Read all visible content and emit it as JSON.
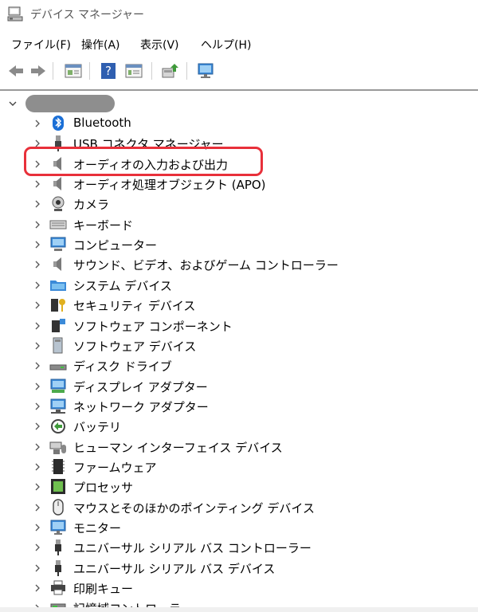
{
  "window": {
    "title": "デバイス マネージャー"
  },
  "menu": {
    "items": [
      "ファイル(F)",
      "操作(A)",
      "表示(V)",
      "ヘルプ(H)"
    ]
  },
  "toolbar": {
    "buttons": [
      "back",
      "forward",
      "properties",
      "help",
      "view-hidden",
      "update-driver",
      "scan-hardware"
    ]
  },
  "tree": {
    "root_label_redacted": true,
    "items": [
      {
        "label": "Bluetooth",
        "icon": "bluetooth-icon"
      },
      {
        "label": "USB コネクタ マネージャー",
        "icon": "usb-connector-icon"
      },
      {
        "label": "オーディオの入力および出力",
        "icon": "speaker-icon",
        "highlighted": true
      },
      {
        "label": "オーディオ処理オブジェクト (APO)",
        "icon": "speaker-icon"
      },
      {
        "label": "カメラ",
        "icon": "camera-icon"
      },
      {
        "label": "キーボード",
        "icon": "keyboard-icon"
      },
      {
        "label": "コンピューター",
        "icon": "computer-icon"
      },
      {
        "label": "サウンド、ビデオ、およびゲーム コントローラー",
        "icon": "speaker-icon"
      },
      {
        "label": "システム デバイス",
        "icon": "system-folder-icon"
      },
      {
        "label": "セキュリティ デバイス",
        "icon": "security-key-icon"
      },
      {
        "label": "ソフトウェア コンポーネント",
        "icon": "software-component-icon"
      },
      {
        "label": "ソフトウェア デバイス",
        "icon": "software-device-icon"
      },
      {
        "label": "ディスク ドライブ",
        "icon": "disk-drive-icon"
      },
      {
        "label": "ディスプレイ アダプター",
        "icon": "display-adapter-icon"
      },
      {
        "label": "ネットワーク アダプター",
        "icon": "network-adapter-icon"
      },
      {
        "label": "バッテリ",
        "icon": "battery-icon"
      },
      {
        "label": "ヒューマン インターフェイス デバイス",
        "icon": "hid-icon"
      },
      {
        "label": "ファームウェア",
        "icon": "firmware-chip-icon"
      },
      {
        "label": "プロセッサ",
        "icon": "processor-icon"
      },
      {
        "label": "マウスとそのほかのポインティング デバイス",
        "icon": "mouse-icon"
      },
      {
        "label": "モニター",
        "icon": "monitor-icon"
      },
      {
        "label": "ユニバーサル シリアル バス コントローラー",
        "icon": "usb-plug-icon"
      },
      {
        "label": "ユニバーサル シリアル バス デバイス",
        "icon": "usb-plug-icon"
      },
      {
        "label": "印刷キュー",
        "icon": "printer-icon"
      },
      {
        "label": "記憶域コントローラー",
        "icon": "storage-controller-icon"
      }
    ]
  },
  "colors": {
    "highlight": "#e8303a",
    "bluetooth": "#1b6fd6"
  }
}
